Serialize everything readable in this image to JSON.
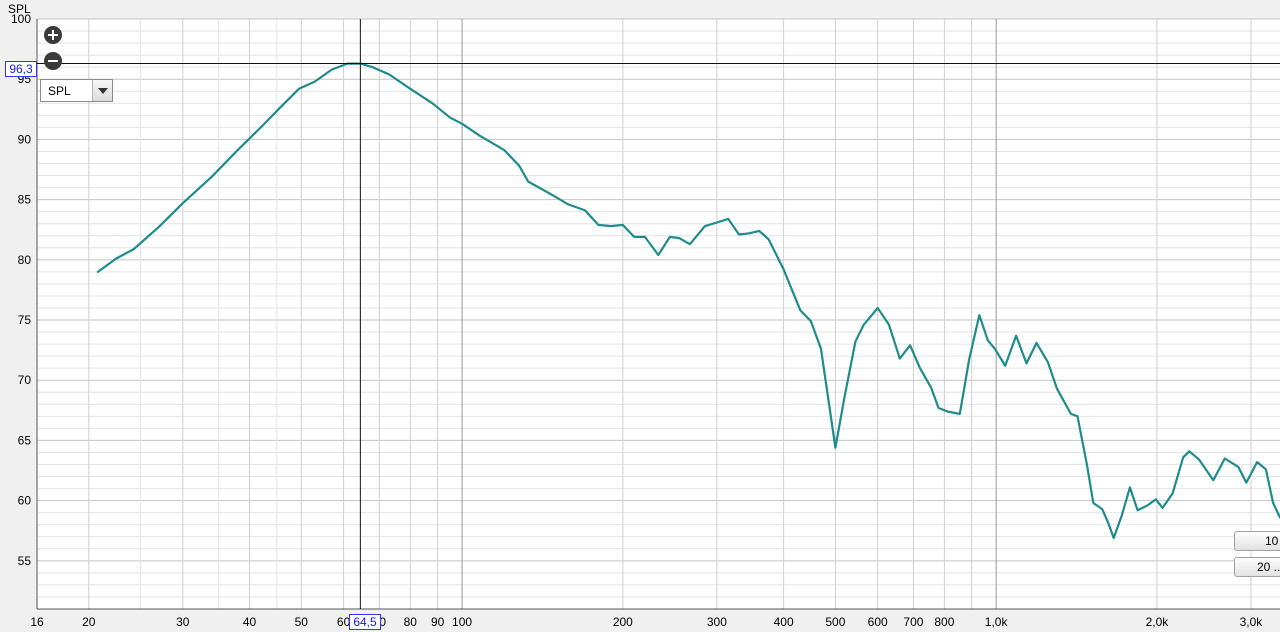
{
  "chart_data": {
    "type": "line",
    "y_axis_title": "SPL",
    "x_scale": "log",
    "x_range": [
      16,
      3400
    ],
    "y_range": [
      51,
      100
    ],
    "x_ticks": [
      {
        "v": 16,
        "label": "16"
      },
      {
        "v": 20,
        "label": "20"
      },
      {
        "v": 30,
        "label": "30"
      },
      {
        "v": 40,
        "label": "40"
      },
      {
        "v": 50,
        "label": "50"
      },
      {
        "v": 60,
        "label": "60"
      },
      {
        "v": 70,
        "label": "70"
      },
      {
        "v": 80,
        "label": "80"
      },
      {
        "v": 90,
        "label": "90"
      },
      {
        "v": 100,
        "label": "100"
      },
      {
        "v": 200,
        "label": "200"
      },
      {
        "v": 300,
        "label": "300"
      },
      {
        "v": 400,
        "label": "400"
      },
      {
        "v": 500,
        "label": "500"
      },
      {
        "v": 600,
        "label": "600"
      },
      {
        "v": 700,
        "label": "700"
      },
      {
        "v": 800,
        "label": "800"
      },
      {
        "v": 1000,
        "label": "1,0k"
      },
      {
        "v": 2000,
        "label": "2,0k"
      },
      {
        "v": 3000,
        "label": "3,0k"
      }
    ],
    "y_ticks": [
      100,
      95,
      90,
      85,
      80,
      75,
      70,
      65,
      60,
      55
    ],
    "grid": true,
    "line_color": "#1e8c8c",
    "series": [
      {
        "points": [
          [
            20.8,
            79.0
          ],
          [
            22.5,
            80.1
          ],
          [
            24.3,
            80.9
          ],
          [
            27,
            82.7
          ],
          [
            30,
            84.7
          ],
          [
            34,
            86.9
          ],
          [
            38,
            89.1
          ],
          [
            42,
            91.0
          ],
          [
            46,
            92.8
          ],
          [
            49.5,
            94.2
          ],
          [
            53,
            94.8
          ],
          [
            57,
            95.8
          ],
          [
            61,
            96.3
          ],
          [
            64.5,
            96.3
          ],
          [
            68,
            96.0
          ],
          [
            73,
            95.4
          ],
          [
            80,
            94.2
          ],
          [
            88,
            93.0
          ],
          [
            95,
            91.8
          ],
          [
            100,
            91.3
          ],
          [
            108,
            90.3
          ],
          [
            120,
            89.1
          ],
          [
            128,
            87.8
          ],
          [
            133,
            86.5
          ],
          [
            142,
            85.8
          ],
          [
            150,
            85.2
          ],
          [
            158,
            84.6
          ],
          [
            170,
            84.1
          ],
          [
            180,
            82.9
          ],
          [
            190,
            82.8
          ],
          [
            200,
            82.9
          ],
          [
            210,
            81.9
          ],
          [
            220,
            81.9
          ],
          [
            233,
            80.4
          ],
          [
            245,
            81.9
          ],
          [
            255,
            81.8
          ],
          [
            267,
            81.3
          ],
          [
            285,
            82.8
          ],
          [
            300,
            83.1
          ],
          [
            315,
            83.4
          ],
          [
            330,
            82.1
          ],
          [
            345,
            82.2
          ],
          [
            360,
            82.4
          ],
          [
            375,
            81.7
          ],
          [
            400,
            79.2
          ],
          [
            430,
            75.8
          ],
          [
            450,
            74.9
          ],
          [
            470,
            72.6
          ],
          [
            500,
            64.4
          ],
          [
            520,
            68.6
          ],
          [
            545,
            73.2
          ],
          [
            565,
            74.6
          ],
          [
            600,
            76.0
          ],
          [
            630,
            74.6
          ],
          [
            660,
            71.8
          ],
          [
            690,
            72.9
          ],
          [
            720,
            71.0
          ],
          [
            755,
            69.4
          ],
          [
            780,
            67.7
          ],
          [
            810,
            67.4
          ],
          [
            855,
            67.2
          ],
          [
            890,
            71.7
          ],
          [
            930,
            75.4
          ],
          [
            965,
            73.3
          ],
          [
            995,
            72.6
          ],
          [
            1040,
            71.2
          ],
          [
            1090,
            73.7
          ],
          [
            1140,
            71.4
          ],
          [
            1190,
            73.1
          ],
          [
            1250,
            71.5
          ],
          [
            1300,
            69.3
          ],
          [
            1380,
            67.2
          ],
          [
            1420,
            67.0
          ],
          [
            1480,
            62.9
          ],
          [
            1520,
            59.8
          ],
          [
            1580,
            59.3
          ],
          [
            1620,
            58.2
          ],
          [
            1660,
            56.9
          ],
          [
            1720,
            58.8
          ],
          [
            1780,
            61.1
          ],
          [
            1840,
            59.2
          ],
          [
            1920,
            59.6
          ],
          [
            1990,
            60.1
          ],
          [
            2050,
            59.4
          ],
          [
            2140,
            60.6
          ],
          [
            2240,
            63.6
          ],
          [
            2300,
            64.1
          ],
          [
            2400,
            63.4
          ],
          [
            2550,
            61.7
          ],
          [
            2680,
            63.5
          ],
          [
            2840,
            62.8
          ],
          [
            2940,
            61.5
          ],
          [
            3080,
            63.2
          ],
          [
            3200,
            62.6
          ],
          [
            3300,
            59.8
          ],
          [
            3400,
            58.6
          ]
        ]
      }
    ],
    "cursor": {
      "x": 64.5,
      "y": 96.3,
      "x_label": "64,5",
      "y_label": "96,3"
    }
  },
  "controls": {
    "measure_select_value": "SPL",
    "side_button_1": "10",
    "side_button_2": "20 ..."
  }
}
